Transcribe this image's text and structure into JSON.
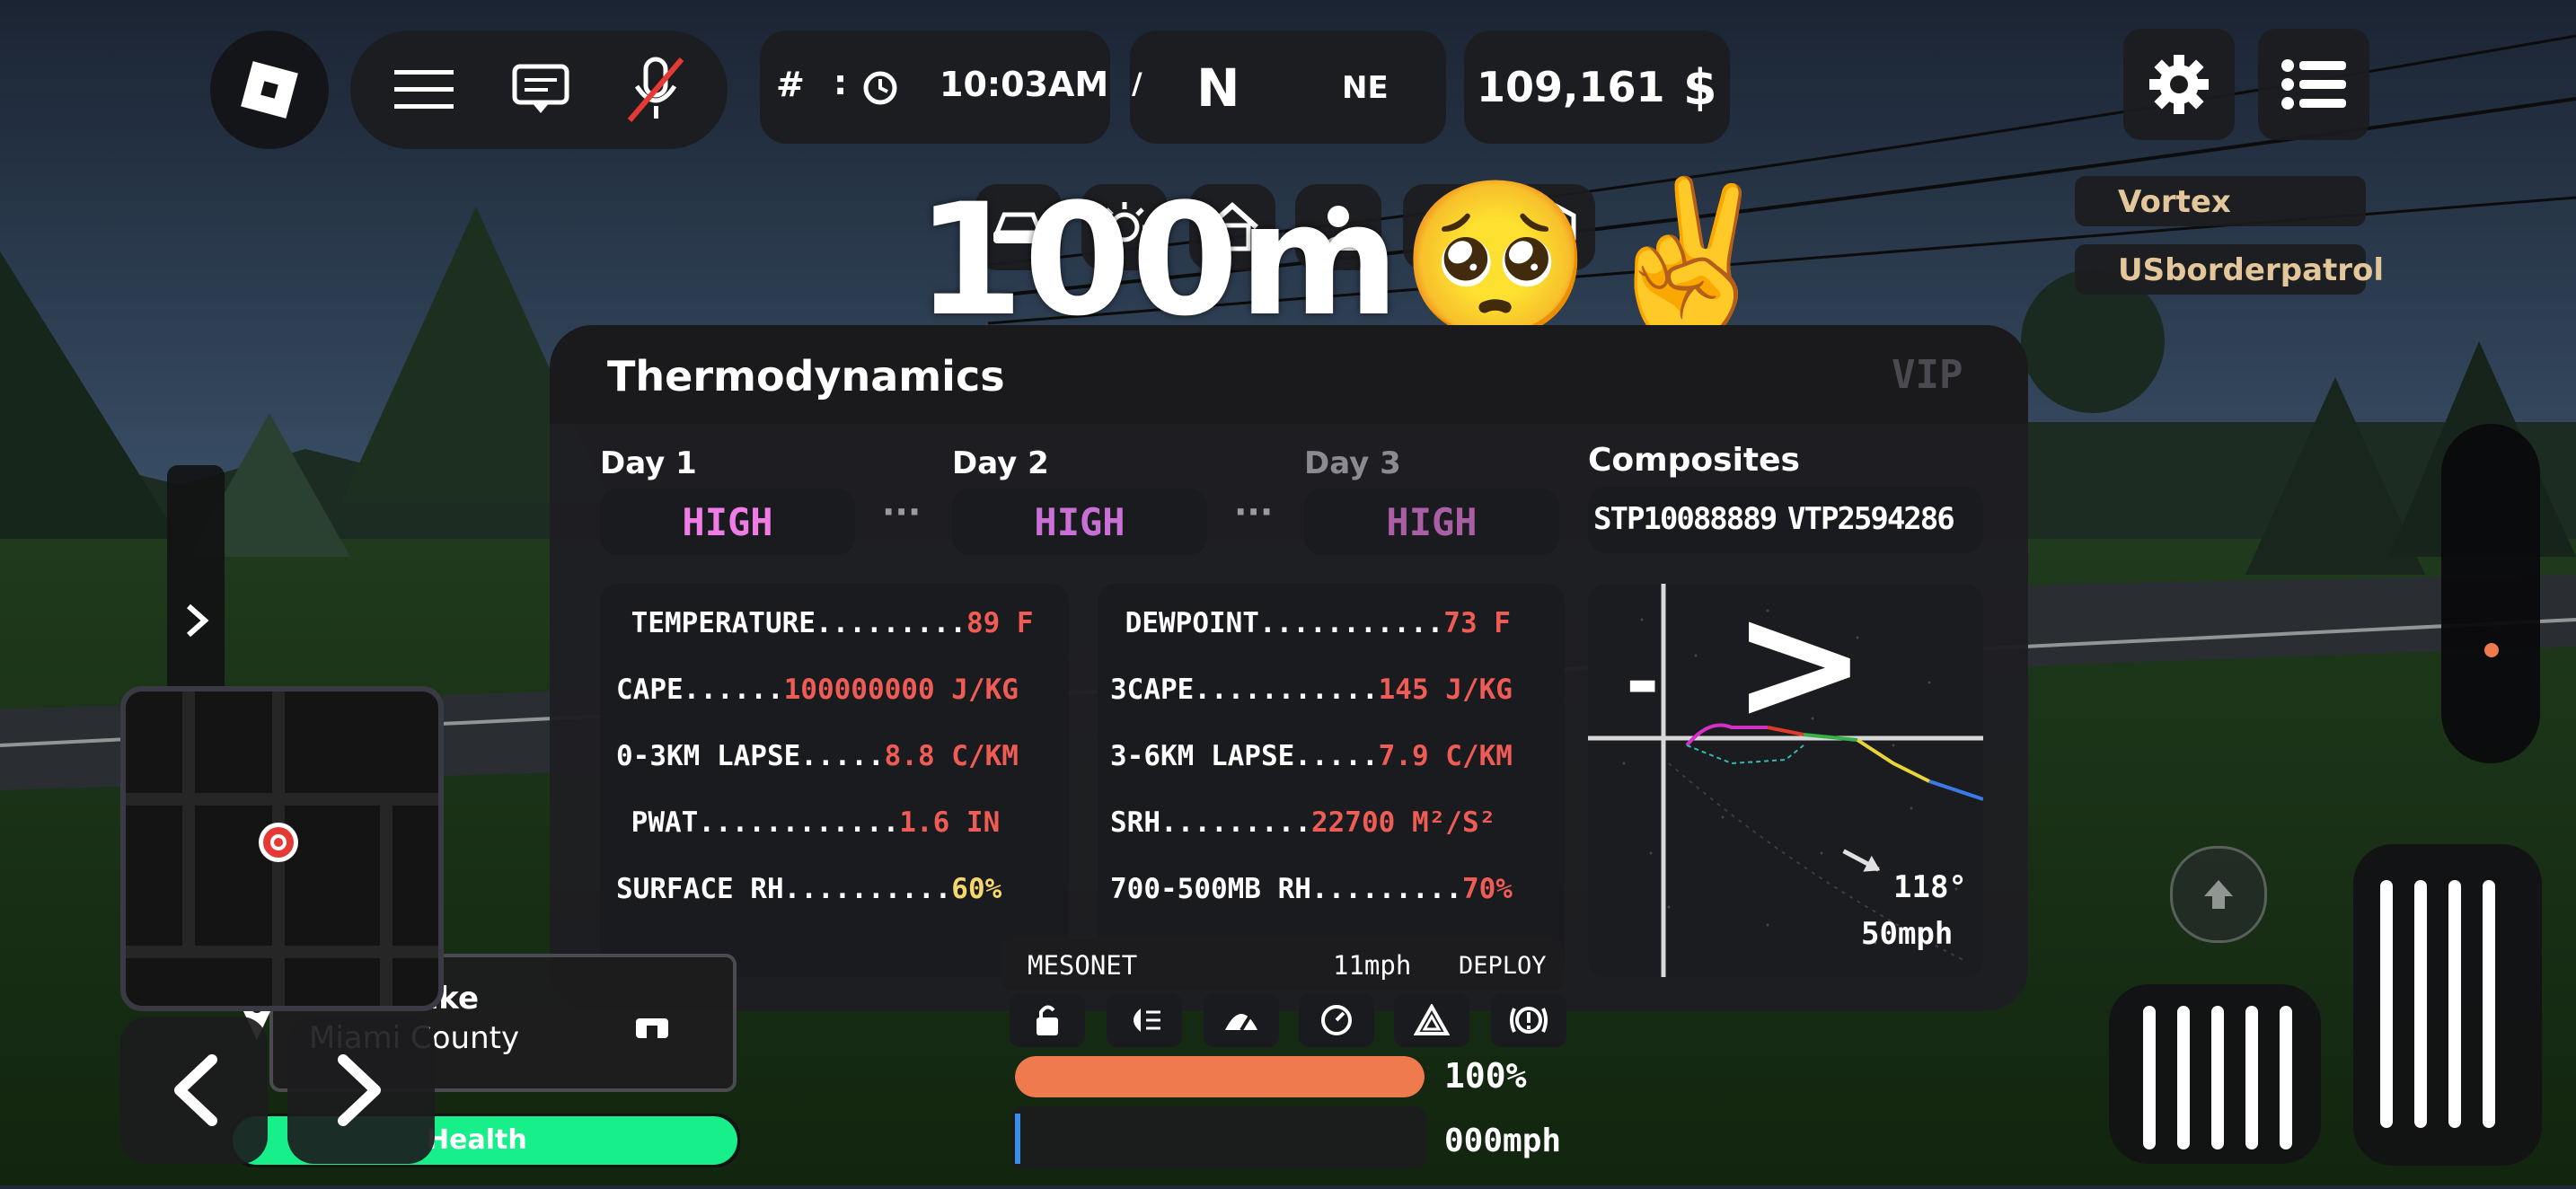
{
  "topbar": {
    "time_prefix": "#",
    "time_sep": ":",
    "time": "10:03AM",
    "compass_left": "/",
    "compass_primary": "N",
    "compass_secondary": "NE",
    "money": "109,161",
    "currency": "$"
  },
  "players": [
    "Vortex",
    "USborderpatrol"
  ],
  "overlay_text": "100m🥺✌️",
  "panel": {
    "title": "Thermodynamics",
    "badge": "VIP",
    "days": [
      {
        "label": "Day 1",
        "risk": "HIGH"
      },
      {
        "label": "Day 2",
        "risk": "HIGH"
      },
      {
        "label": "Day 3",
        "risk": "HIGH"
      }
    ],
    "ellipsis": "···",
    "composites_label": "Composites",
    "stp": "STP10088889",
    "vtp": "VTP2594286",
    "left_stats": [
      {
        "label": " TEMPERATURE.........",
        "value": "89 F"
      },
      {
        "label": "CAPE......",
        "value": "100000000 J/KG"
      },
      {
        "label": "0-3KM LAPSE.....",
        "value": "8.8 C/KM"
      },
      {
        "label": " PWAT............",
        "value": "1.6 IN"
      },
      {
        "label": "SURFACE RH..........",
        "value": "60%"
      }
    ],
    "right_stats": [
      {
        "label": " DEWPOINT...........",
        "value": "73 F"
      },
      {
        "label": "3CAPE...........",
        "value": "145 J/KG"
      },
      {
        "label": "3-6KM LAPSE.....",
        "value": "7.9 C/KM"
      },
      {
        "label": "SRH.........",
        "value": "22700 M²/S²"
      },
      {
        "label": "700-500MB RH.........",
        "value": "70%"
      }
    ],
    "hodo_dir": "118°",
    "hodo_speed": "50mph"
  },
  "vehicle": {
    "mesonet": "MESONET",
    "wind": "11mph",
    "deploy": "DEPLOY",
    "fuel_percent_text": "100%",
    "fuel_fraction": 1.0,
    "speed": "000mph"
  },
  "location": {
    "place": "Pilot Lake",
    "county": "Miami County",
    "health_label": "Health",
    "health_fraction": 1.0
  },
  "colors": {
    "orange": "#ee7a4e",
    "green": "#17f08a",
    "red_value": "#ef5b55",
    "yellow_value": "#f5d76e",
    "pink_high": "#f07ce6",
    "violet_high": "#c870d6",
    "mauve_high": "#a95ea6"
  }
}
